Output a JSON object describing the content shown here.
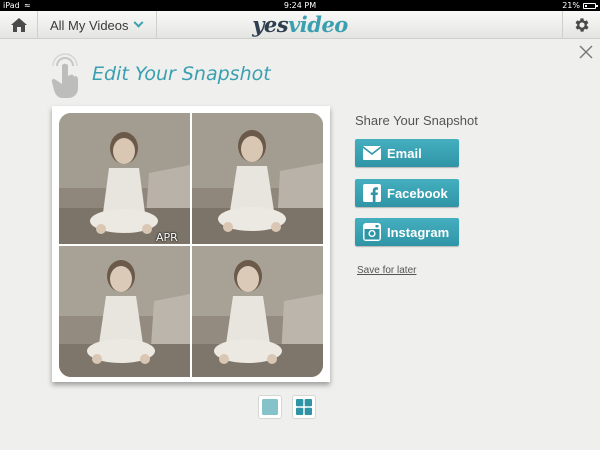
{
  "status_bar": {
    "carrier": "iPad",
    "time": "9:24 PM",
    "battery_percent": "21%",
    "battery_level": 0.21
  },
  "toolbar": {
    "home_icon": "home-icon",
    "video_selector_label": "All My Videos",
    "logo_part1": "yes",
    "logo_part2": "video",
    "settings_icon": "gear-icon"
  },
  "page": {
    "title": "Edit Your Snapshot",
    "close_icon": "close-icon",
    "gesture_icon": "tap-hand-icon"
  },
  "snapshot": {
    "frames": [
      {
        "date": "APR"
      },
      {
        "date": ""
      },
      {
        "date": ""
      },
      {
        "date": ""
      }
    ]
  },
  "share": {
    "heading": "Share Your Snapshot",
    "email_label": "Email",
    "facebook_label": "Facebook",
    "instagram_label": "Instagram",
    "save_label": "Save for later"
  },
  "layout_options": {
    "selected": "grid"
  },
  "colors": {
    "accent": "#3aa0b1",
    "logo_dark": "#2d3e50",
    "background": "#efefed"
  }
}
